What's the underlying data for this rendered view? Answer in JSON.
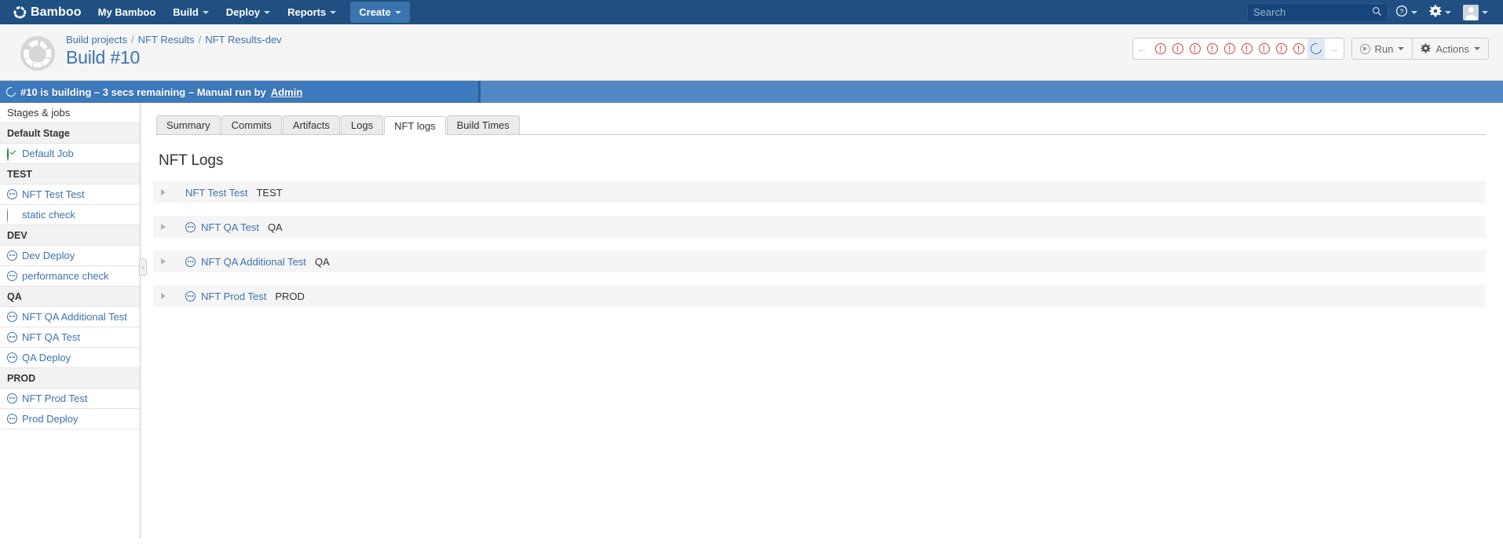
{
  "topnav": {
    "brand": "Bamboo",
    "brand_icon": "bamboo-logo-icon",
    "items": [
      {
        "label": "My Bamboo",
        "has_caret": false
      },
      {
        "label": "Build",
        "has_caret": true
      },
      {
        "label": "Deploy",
        "has_caret": true
      },
      {
        "label": "Reports",
        "has_caret": true
      }
    ],
    "create_label": "Create",
    "search": {
      "placeholder": "Search",
      "value": "",
      "icon": "search-icon"
    },
    "help_icon": "help-circle-icon",
    "settings_icon": "gear-icon",
    "avatar_icon": "user-avatar-icon",
    "bg_color": "#205081"
  },
  "header": {
    "avatar_icon": "build-plan-avatar-icon",
    "breadcrumb": [
      {
        "label": "Build projects"
      },
      {
        "label": "NFT Results"
      },
      {
        "label": "NFT Results-dev"
      }
    ],
    "breadcrumb_separator": "/",
    "title": "Build #10",
    "result_strip": {
      "prev_arrow": "←",
      "next_arrow": "→",
      "items": [
        {
          "status": "failed",
          "icon": "error-circle-icon"
        },
        {
          "status": "failed",
          "icon": "error-circle-icon"
        },
        {
          "status": "failed",
          "icon": "error-circle-icon"
        },
        {
          "status": "failed",
          "icon": "error-circle-icon"
        },
        {
          "status": "failed",
          "icon": "error-circle-icon"
        },
        {
          "status": "failed",
          "icon": "error-circle-icon"
        },
        {
          "status": "failed",
          "icon": "error-circle-icon"
        },
        {
          "status": "failed",
          "icon": "error-circle-icon"
        },
        {
          "status": "failed",
          "icon": "error-circle-icon"
        },
        {
          "status": "in-progress",
          "icon": "spinner-icon",
          "current": true
        }
      ]
    },
    "run_label": "Run",
    "run_icon": "play-circle-icon",
    "actions_label": "Actions",
    "actions_icon": "gear-icon"
  },
  "statusbar": {
    "icon": "spinner-icon",
    "text_prefix": "#10 is building – 3 secs remaining – Manual run by",
    "user_link": "Admin",
    "progress_percent": 32,
    "bg_color": "#5287c6",
    "fill_color": "#3d79bd"
  },
  "sidebar": {
    "title": "Stages & jobs",
    "collapse_icon": "chevron-left-icon",
    "groups": [
      {
        "stage": "Default Stage",
        "jobs": [
          {
            "label": "Default Job",
            "status": "successful",
            "icon": "check-circle-icon"
          }
        ]
      },
      {
        "stage": "TEST",
        "jobs": [
          {
            "label": "NFT Test Test",
            "status": "pending",
            "icon": "pending-circle-icon"
          },
          {
            "label": "static check",
            "status": "in-progress",
            "icon": "spinner-icon"
          }
        ]
      },
      {
        "stage": "DEV",
        "jobs": [
          {
            "label": "Dev Deploy",
            "status": "pending",
            "icon": "pending-circle-icon"
          },
          {
            "label": "performance check",
            "status": "pending",
            "icon": "pending-circle-icon"
          }
        ]
      },
      {
        "stage": "QA",
        "jobs": [
          {
            "label": "NFT QA Additional Test",
            "status": "pending",
            "icon": "pending-circle-icon"
          },
          {
            "label": "NFT QA Test",
            "status": "pending",
            "icon": "pending-circle-icon"
          },
          {
            "label": "QA Deploy",
            "status": "pending",
            "icon": "pending-circle-icon"
          }
        ]
      },
      {
        "stage": "PROD",
        "jobs": [
          {
            "label": "NFT Prod Test",
            "status": "pending",
            "icon": "pending-circle-icon"
          },
          {
            "label": "Prod Deploy",
            "status": "pending",
            "icon": "pending-circle-icon"
          }
        ]
      }
    ]
  },
  "main": {
    "tabs": [
      {
        "label": "Summary",
        "active": false
      },
      {
        "label": "Commits",
        "active": false
      },
      {
        "label": "Artifacts",
        "active": false
      },
      {
        "label": "Logs",
        "active": false
      },
      {
        "label": "NFT logs",
        "active": true
      },
      {
        "label": "Build Times",
        "active": false
      }
    ],
    "content_title": "NFT Logs",
    "log_rows": [
      {
        "name": "NFT Test Test",
        "env": "TEST",
        "status": "none",
        "icon": "",
        "expand_icon": "triangle-right-icon"
      },
      {
        "name": "NFT QA Test",
        "env": "QA",
        "status": "pending",
        "icon": "pending-circle-icon",
        "expand_icon": "triangle-right-icon"
      },
      {
        "name": "NFT QA Additional Test",
        "env": "QA",
        "status": "pending",
        "icon": "pending-circle-icon",
        "expand_icon": "triangle-right-icon"
      },
      {
        "name": "NFT Prod Test",
        "env": "PROD",
        "status": "pending",
        "icon": "pending-circle-icon",
        "expand_icon": "triangle-right-icon"
      }
    ]
  },
  "colors": {
    "brand_blue": "#205081",
    "link_blue": "#3b73af",
    "fail_red": "#d04437",
    "success_green": "#14892c"
  }
}
